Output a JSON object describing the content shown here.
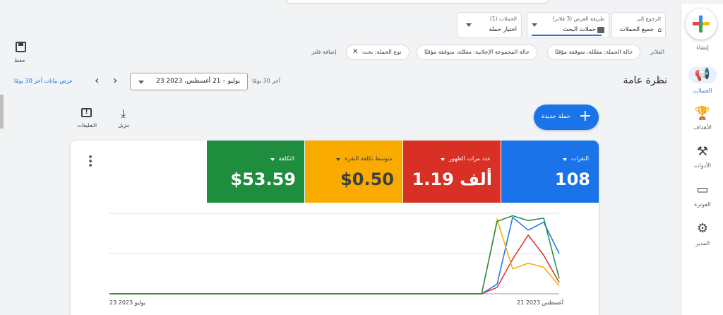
{
  "rail": {
    "create_label": "إنشاء",
    "items": [
      {
        "label": "الحملات",
        "icon": "megaphone-icon"
      },
      {
        "label": "الأهداف",
        "icon": "trophy-icon"
      },
      {
        "label": "الأدوات",
        "icon": "tools-icon"
      },
      {
        "label": "الفوترة",
        "icon": "credit-card-icon"
      },
      {
        "label": "المدير",
        "icon": "gear-icon"
      }
    ]
  },
  "breadcrumb": {
    "back_small": "الرجوع إلى",
    "back_main": "جميع الحملات",
    "view_small": "طريقة العرض (3 فلاتر)",
    "view_main": "حملات البحث",
    "campaigns_small": "الحملات (1)",
    "campaigns_main": "اختيار حملة"
  },
  "toolbar": {
    "save_label": "حفظ"
  },
  "filters": {
    "label": "الفلاتر",
    "chips": [
      "حالة الحملة: مفعّلة، متوقفة مؤقتًا",
      "حالة المجموعة الإعلانية: مفعّلة، متوقفة مؤقتًا",
      "نوع الحملة: بحث"
    ],
    "add_label": "إضافة فلتر"
  },
  "header": {
    "title": "نظرة عامة",
    "range_label": "آخر 30 يومًا",
    "date_range": "23 يوليو – 21 أغسطس، 2023",
    "show_last_30": "عرض بيانات آخر 30 يومًا"
  },
  "actions": {
    "new_campaign": "حملة جديدة",
    "download": "تنزيل",
    "feedback": "التعليقات"
  },
  "metrics": [
    {
      "label": "النقرات",
      "value": "108",
      "color": "#1a73e8"
    },
    {
      "label": "عدد مرات الظهور",
      "value": "1.19 ألف",
      "color": "#d93025"
    },
    {
      "label": "متوسط تكلفة النقرة",
      "value": "$0.50",
      "color": "#f9ab00"
    },
    {
      "label": "التكلفة",
      "value": "$53.59",
      "color": "#1e8e3e"
    }
  ],
  "chart_data": {
    "type": "line",
    "x_start_label": "23 يوليو 2023",
    "x_end_label": "21 أغسطس 2023",
    "x": [
      0,
      1,
      2,
      3,
      4,
      5,
      6,
      7,
      8,
      9,
      10,
      11,
      12,
      13,
      14,
      15,
      16,
      17,
      18,
      19,
      20,
      21,
      22,
      23,
      24,
      25,
      26,
      27,
      28,
      29
    ],
    "series": [
      {
        "name": "النقرات",
        "color": "#1a73e8",
        "values": [
          0,
          0,
          0,
          0,
          0,
          0,
          0,
          0,
          0,
          0,
          0,
          0,
          0,
          0,
          0,
          0,
          0,
          0,
          0,
          0,
          0,
          0,
          0,
          0,
          0,
          0.12,
          0.95,
          0.79,
          0.89,
          0.5
        ]
      },
      {
        "name": "عدد مرات الظهور",
        "color": "#d93025",
        "values": [
          0,
          0,
          0,
          0,
          0,
          0,
          0,
          0,
          0,
          0,
          0,
          0,
          0,
          0,
          0,
          0,
          0,
          0,
          0,
          0,
          0,
          0,
          0,
          0,
          0,
          0.08,
          0.43,
          0.73,
          0.48,
          0.14
        ]
      },
      {
        "name": "متوسط تكلفة النقرة",
        "color": "#f9ab00",
        "values": [
          0,
          0,
          0,
          0,
          0,
          0,
          0,
          0,
          0,
          0,
          0,
          0,
          0,
          0,
          0,
          0,
          0,
          0,
          0,
          0,
          0,
          0,
          0,
          0,
          0,
          0.92,
          0.31,
          0.38,
          0.33,
          0.1
        ]
      },
      {
        "name": "التكلفة",
        "color": "#1e8e3e",
        "values": [
          0,
          0,
          0,
          0,
          0,
          0,
          0,
          0,
          0,
          0,
          0,
          0,
          0,
          0,
          0,
          0,
          0,
          0,
          0,
          0,
          0,
          0,
          0,
          0,
          0,
          0.9,
          0.97,
          0.91,
          0.94,
          0.19
        ]
      }
    ],
    "ylim": [
      0,
      1
    ],
    "grid": true
  }
}
